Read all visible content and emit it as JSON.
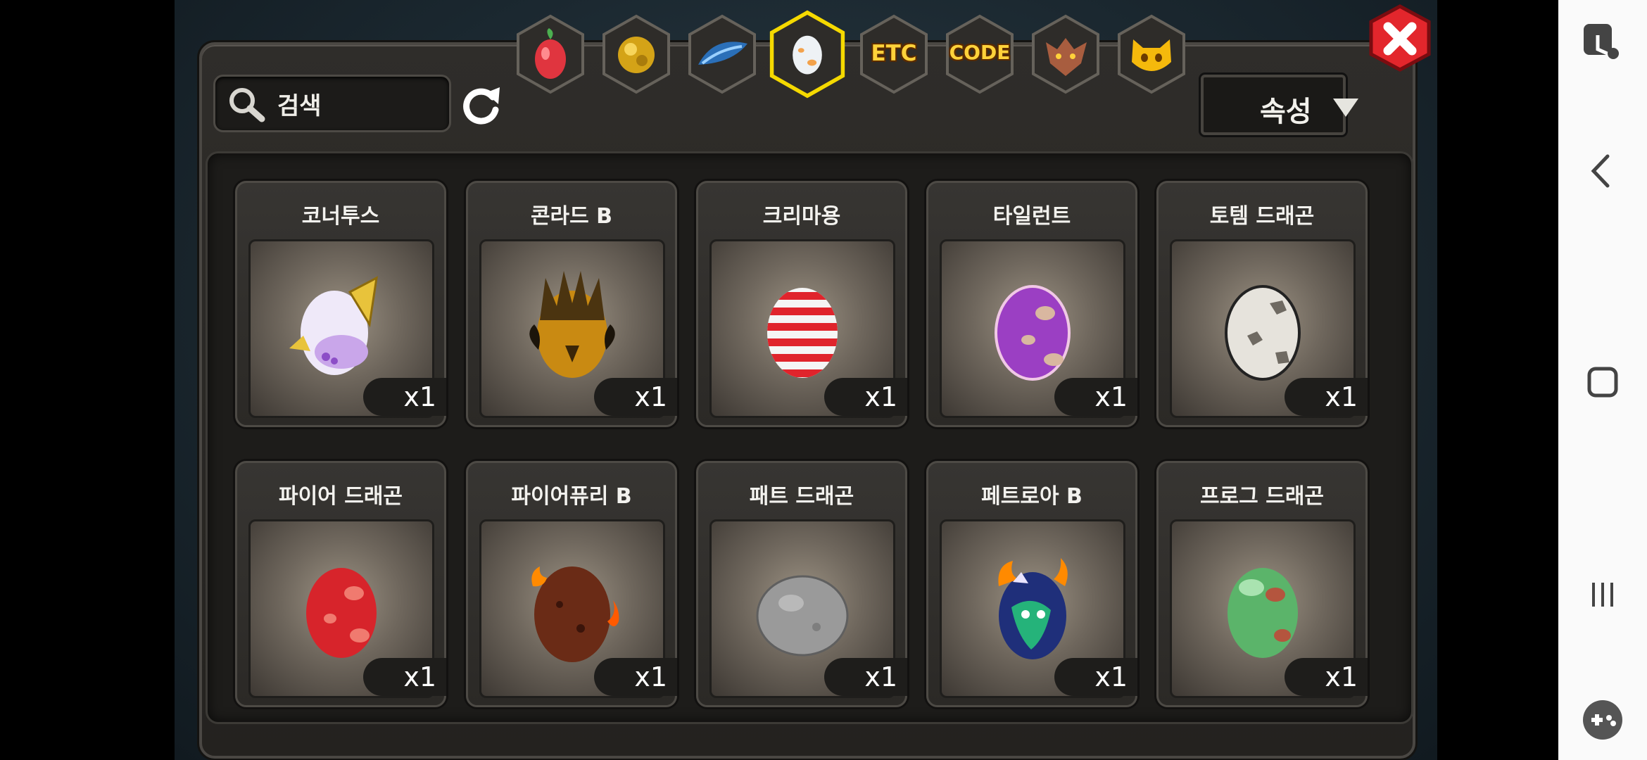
{
  "header": {
    "search_label": "검색",
    "sort_label": "속성",
    "tabs": [
      {
        "id": "fruit",
        "label": "",
        "icon": "fruit-icon"
      },
      {
        "id": "gold",
        "label": "",
        "icon": "gold-ball-icon"
      },
      {
        "id": "feather",
        "label": "",
        "icon": "blue-feather-icon"
      },
      {
        "id": "egg",
        "label": "",
        "icon": "egg-icon",
        "selected": true
      },
      {
        "id": "etc",
        "label": "ETC",
        "icon": ""
      },
      {
        "id": "code",
        "label": "CODE",
        "icon": ""
      },
      {
        "id": "dragon",
        "label": "",
        "icon": "dragon-head-icon"
      },
      {
        "id": "cat",
        "label": "",
        "icon": "cat-face-icon"
      }
    ]
  },
  "items": [
    {
      "name": "코너투스",
      "qty": "x1"
    },
    {
      "name": "콘라드 B",
      "qty": "x1"
    },
    {
      "name": "크리마용",
      "qty": "x1"
    },
    {
      "name": "타일런트",
      "qty": "x1"
    },
    {
      "name": "토템 드래곤",
      "qty": "x1"
    },
    {
      "name": "파이어 드래곤",
      "qty": "x1"
    },
    {
      "name": "파이어퓨리 B",
      "qty": "x1"
    },
    {
      "name": "패트 드래곤",
      "qty": "x1"
    },
    {
      "name": "페트로아 B",
      "qty": "x1"
    },
    {
      "name": "프로그 드래곤",
      "qty": "x1"
    }
  ],
  "colors": {
    "selected_tab": "#f5d900",
    "close_button": "#e3262c",
    "tab_text": "#ffd23a"
  }
}
